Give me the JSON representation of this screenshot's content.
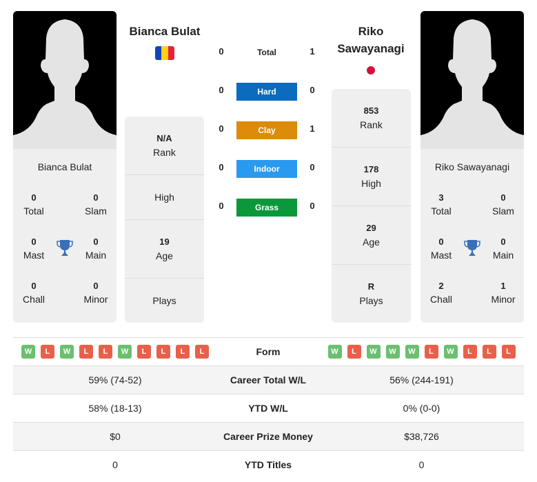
{
  "colors": {
    "hard": "#0b6bbd",
    "clay": "#dc8b0b",
    "indoor": "#2a9af0",
    "grass": "#0b983a",
    "win": "#6bbf6f",
    "loss": "#e9604a",
    "trophy": "#3a6fba"
  },
  "player1": {
    "name": "Bianca Bulat",
    "flag": "romania-flag",
    "card_name": "Bianca Bulat",
    "titles": {
      "total": "0",
      "total_label": "Total",
      "slam": "0",
      "slam_label": "Slam",
      "mast": "0",
      "mast_label": "Mast",
      "main": "0",
      "main_label": "Main",
      "chall": "0",
      "chall_label": "Chall",
      "minor": "0",
      "minor_label": "Minor"
    },
    "stats": {
      "rank": "N/A",
      "rank_label": "Rank",
      "high": "",
      "high_label": "High",
      "age": "19",
      "age_label": "Age",
      "plays": "",
      "plays_label": "Plays"
    }
  },
  "player2": {
    "name": "Riko Sawayanagi",
    "flag": "japan-flag",
    "card_name": "Riko Sawayanagi",
    "titles": {
      "total": "3",
      "total_label": "Total",
      "slam": "0",
      "slam_label": "Slam",
      "mast": "0",
      "mast_label": "Mast",
      "main": "0",
      "main_label": "Main",
      "chall": "2",
      "chall_label": "Chall",
      "minor": "1",
      "minor_label": "Minor"
    },
    "stats": {
      "rank": "853",
      "rank_label": "Rank",
      "high": "178",
      "high_label": "High",
      "age": "29",
      "age_label": "Age",
      "plays": "R",
      "plays_label": "Plays"
    }
  },
  "h2h": {
    "total": {
      "label": "Total",
      "p1": "0",
      "p2": "1"
    },
    "hard": {
      "label": "Hard",
      "p1": "0",
      "p2": "0"
    },
    "clay": {
      "label": "Clay",
      "p1": "0",
      "p2": "1"
    },
    "indoor": {
      "label": "Indoor",
      "p1": "0",
      "p2": "0"
    },
    "grass": {
      "label": "Grass",
      "p1": "0",
      "p2": "0"
    }
  },
  "table": {
    "form": {
      "label": "Form",
      "p1": [
        "W",
        "L",
        "W",
        "L",
        "L",
        "W",
        "L",
        "L",
        "L",
        "L"
      ],
      "p2": [
        "W",
        "L",
        "W",
        "W",
        "W",
        "L",
        "W",
        "L",
        "L",
        "L"
      ]
    },
    "rows": [
      {
        "label": "Career Total W/L",
        "p1": "59% (74-52)",
        "p2": "56% (244-191)"
      },
      {
        "label": "YTD W/L",
        "p1": "58% (18-13)",
        "p2": "0% (0-0)"
      },
      {
        "label": "Career Prize Money",
        "p1": "$0",
        "p2": "$38,726"
      },
      {
        "label": "YTD Titles",
        "p1": "0",
        "p2": "0"
      }
    ]
  }
}
